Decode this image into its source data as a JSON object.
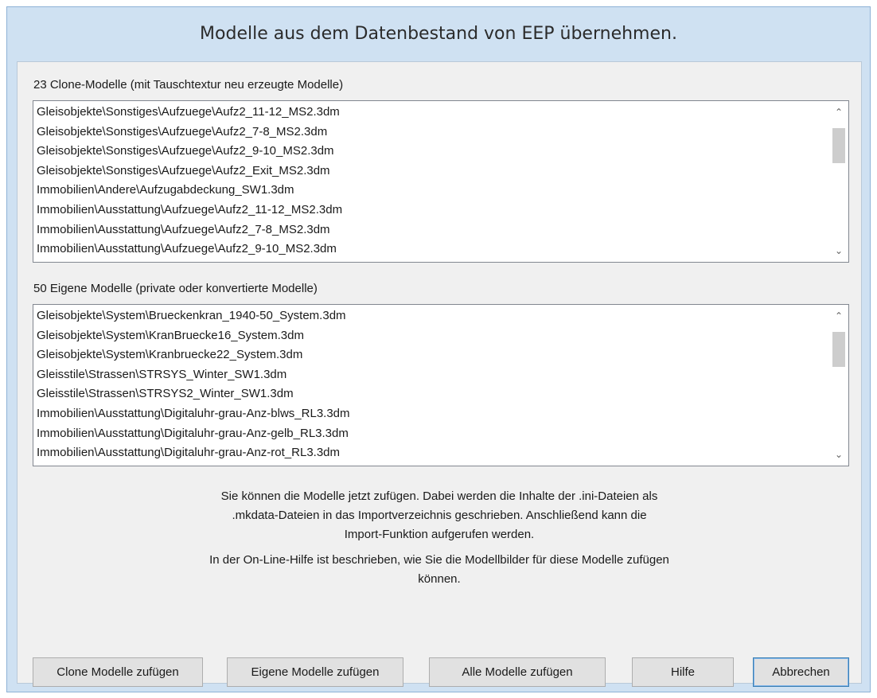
{
  "dialog": {
    "title": "Modelle aus dem Datenbestand von EEP übernehmen."
  },
  "clone_list": {
    "label": "23 Clone-Modelle (mit Tauschtextur neu erzeugte Modelle)",
    "items": [
      "Gleisobjekte\\Sonstiges\\Aufzuege\\Aufz2_11-12_MS2.3dm",
      "Gleisobjekte\\Sonstiges\\Aufzuege\\Aufz2_7-8_MS2.3dm",
      "Gleisobjekte\\Sonstiges\\Aufzuege\\Aufz2_9-10_MS2.3dm",
      "Gleisobjekte\\Sonstiges\\Aufzuege\\Aufz2_Exit_MS2.3dm",
      "Immobilien\\Andere\\Aufzugabdeckung_SW1.3dm",
      "Immobilien\\Ausstattung\\Aufzuege\\Aufz2_11-12_MS2.3dm",
      "Immobilien\\Ausstattung\\Aufzuege\\Aufz2_7-8_MS2.3dm",
      "Immobilien\\Ausstattung\\Aufzuege\\Aufz2_9-10_MS2.3dm"
    ]
  },
  "own_list": {
    "label": "50 Eigene Modelle (private oder konvertierte Modelle)",
    "items": [
      "Gleisobjekte\\System\\Brueckenkran_1940-50_System.3dm",
      "Gleisobjekte\\System\\KranBruecke16_System.3dm",
      "Gleisobjekte\\System\\Kranbruecke22_System.3dm",
      "Gleisstile\\Strassen\\STRSYS_Winter_SW1.3dm",
      "Gleisstile\\Strassen\\STRSYS2_Winter_SW1.3dm",
      "Immobilien\\Ausstattung\\Digitaluhr-grau-Anz-blws_RL3.3dm",
      "Immobilien\\Ausstattung\\Digitaluhr-grau-Anz-gelb_RL3.3dm",
      "Immobilien\\Ausstattung\\Digitaluhr-grau-Anz-rot_RL3.3dm"
    ]
  },
  "info": {
    "paragraph1": [
      "Sie können die Modelle jetzt zufügen. Dabei werden die Inhalte der .ini-Dateien als",
      ".mkdata-Dateien in das Importverzeichnis geschrieben. Anschließend kann die",
      "Import-Funktion aufgerufen werden."
    ],
    "paragraph2": [
      "In der On-Line-Hilfe ist beschrieben, wie Sie die Modellbilder für diese Modelle zufügen",
      "können."
    ]
  },
  "buttons": {
    "clone": "Clone Modelle zufügen",
    "own": "Eigene Modelle zufügen",
    "all": "Alle Modelle zufügen",
    "help": "Hilfe",
    "cancel": "Abbrechen"
  },
  "icons": {
    "scroll_up": "chevron-up-icon",
    "scroll_down": "chevron-down-icon"
  }
}
